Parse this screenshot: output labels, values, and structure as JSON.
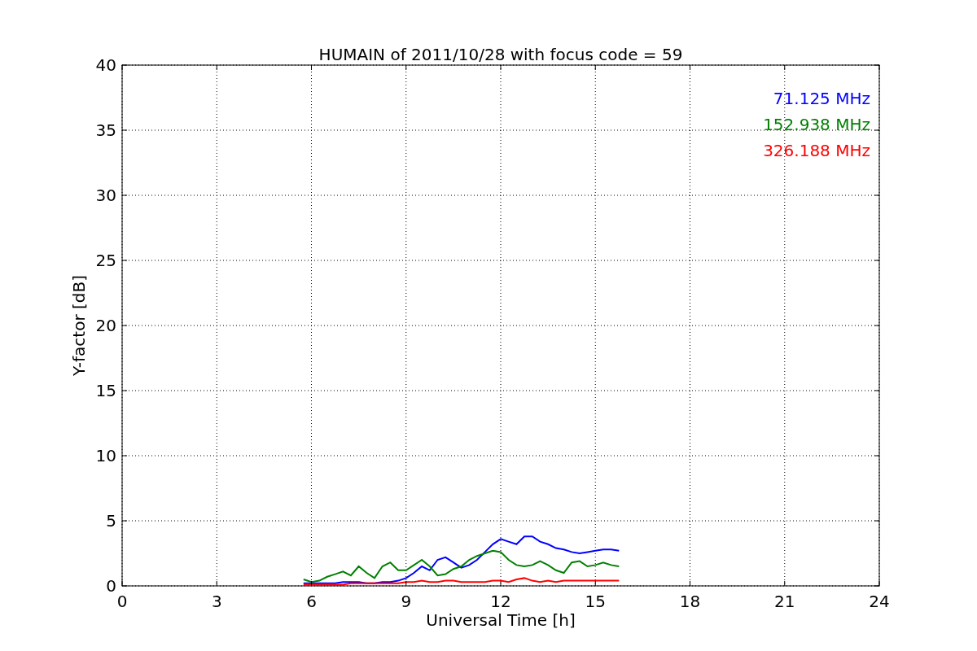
{
  "chart_data": {
    "type": "line",
    "title": "HUMAIN of 2011/10/28 with focus code = 59",
    "xlabel": "Universal Time [h]",
    "ylabel": "Y-factor [dB]",
    "x": [
      5.75,
      6,
      6.25,
      6.5,
      6.75,
      7,
      7.25,
      7.5,
      7.75,
      8,
      8.25,
      8.5,
      8.75,
      9,
      9.25,
      9.5,
      9.75,
      10,
      10.25,
      10.5,
      10.75,
      11,
      11.25,
      11.5,
      11.75,
      12,
      12.25,
      12.5,
      12.75,
      13,
      13.25,
      13.5,
      13.75,
      14,
      14.25,
      14.5,
      14.75,
      15,
      15.25,
      15.5,
      15.75
    ],
    "series": [
      {
        "name": "71.125 MHz",
        "color": "#0000ff",
        "values": [
          0.2,
          0.2,
          0.2,
          0.2,
          0.2,
          0.3,
          0.3,
          0.3,
          0.2,
          0.2,
          0.3,
          0.3,
          0.4,
          0.6,
          1.0,
          1.5,
          1.2,
          2.0,
          2.2,
          1.8,
          1.4,
          1.6,
          2.0,
          2.6,
          3.2,
          3.6,
          3.4,
          3.2,
          3.8,
          3.8,
          3.4,
          3.2,
          2.9,
          2.8,
          2.6,
          2.5,
          2.6,
          2.7,
          2.8,
          2.8,
          2.7
        ]
      },
      {
        "name": "152.938 MHz",
        "color": "#008000",
        "values": [
          0.5,
          0.3,
          0.4,
          0.7,
          0.9,
          1.1,
          0.8,
          1.5,
          1.0,
          0.6,
          1.5,
          1.8,
          1.2,
          1.2,
          1.6,
          2.0,
          1.5,
          0.8,
          0.9,
          1.3,
          1.5,
          2.0,
          2.3,
          2.5,
          2.7,
          2.6,
          2.0,
          1.6,
          1.5,
          1.6,
          1.9,
          1.6,
          1.2,
          1.0,
          1.8,
          1.9,
          1.5,
          1.6,
          1.8,
          1.6,
          1.5
        ]
      },
      {
        "name": "326.188 MHz",
        "color": "#ff0000",
        "values": [
          0.1,
          0.1,
          0.1,
          0.1,
          0.1,
          0.1,
          0.2,
          0.2,
          0.2,
          0.2,
          0.2,
          0.2,
          0.2,
          0.3,
          0.3,
          0.4,
          0.3,
          0.3,
          0.4,
          0.4,
          0.3,
          0.3,
          0.3,
          0.3,
          0.4,
          0.4,
          0.3,
          0.5,
          0.6,
          0.4,
          0.3,
          0.4,
          0.3,
          0.4,
          0.4,
          0.4,
          0.4,
          0.4,
          0.4,
          0.4,
          0.4
        ]
      }
    ],
    "xlim": [
      0,
      24
    ],
    "ylim": [
      0,
      40
    ],
    "xticks": [
      0,
      3,
      6,
      9,
      12,
      15,
      18,
      21,
      24
    ],
    "yticks": [
      0,
      5,
      10,
      15,
      20,
      25,
      30,
      35,
      40
    ],
    "grid": true
  }
}
